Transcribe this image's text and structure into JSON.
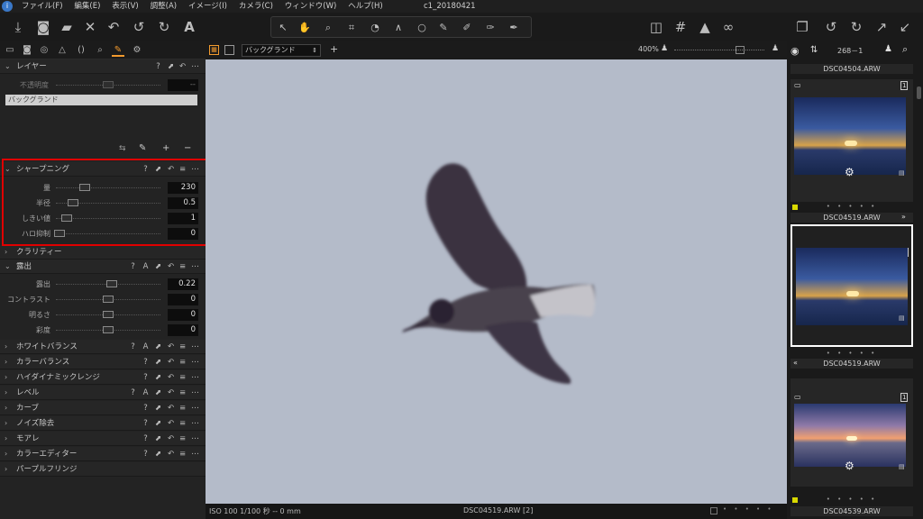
{
  "window": {
    "title": "c1_20180421"
  },
  "menu": [
    "ファイル(F)",
    "編集(E)",
    "表示(V)",
    "調整(A)",
    "イメージ(I)",
    "カメラ(C)",
    "ウィンドウ(W)",
    "ヘルプ(H)"
  ],
  "viewer_header": {
    "variant_select": "バックグランド",
    "zoom": "400%",
    "count": "268－1"
  },
  "layers": {
    "title": "レイヤー",
    "opacity_label": "不透明度",
    "opacity_value": "--",
    "layer_name": "バックグランド"
  },
  "sharpening": {
    "title": "シャープニング",
    "sliders": [
      {
        "label": "量",
        "value": "230"
      },
      {
        "label": "半径",
        "value": "0.5"
      },
      {
        "label": "しきい値",
        "value": "1"
      },
      {
        "label": "ハロ抑制",
        "value": "0"
      }
    ]
  },
  "clarity": {
    "title": "クラリティー"
  },
  "exposure": {
    "title": "露出",
    "sliders": [
      {
        "label": "露出",
        "value": "0.22"
      },
      {
        "label": "コントラスト",
        "value": "0"
      },
      {
        "label": "明るさ",
        "value": "0"
      },
      {
        "label": "彩度",
        "value": "0"
      }
    ]
  },
  "collapsed_sections": [
    "ホワイトバランス",
    "カラーバランス",
    "ハイダイナミックレンジ",
    "レベル",
    "カーブ",
    "ノイズ除去",
    "モアレ",
    "カラーエディター",
    "パープルフリンジ"
  ],
  "viewer_status": {
    "left": "ISO 100  1/100 秒 -- 0 mm",
    "center": "DSC04519.ARW [2]"
  },
  "browser": {
    "top_caption": "DSC04504.ARW",
    "thumbs": [
      {
        "caption": "DSC04519.ARW",
        "badge": "1"
      },
      {
        "caption": "DSC04519.ARW",
        "badge": "2"
      },
      {
        "caption": "DSC04539.ARW",
        "badge": "1"
      }
    ],
    "dots": "• • • • •"
  },
  "icons": {
    "gear": "⚙",
    "help": "?",
    "reset": "↶",
    "menu": "≡",
    "more": "⋯",
    "auto": "A"
  }
}
